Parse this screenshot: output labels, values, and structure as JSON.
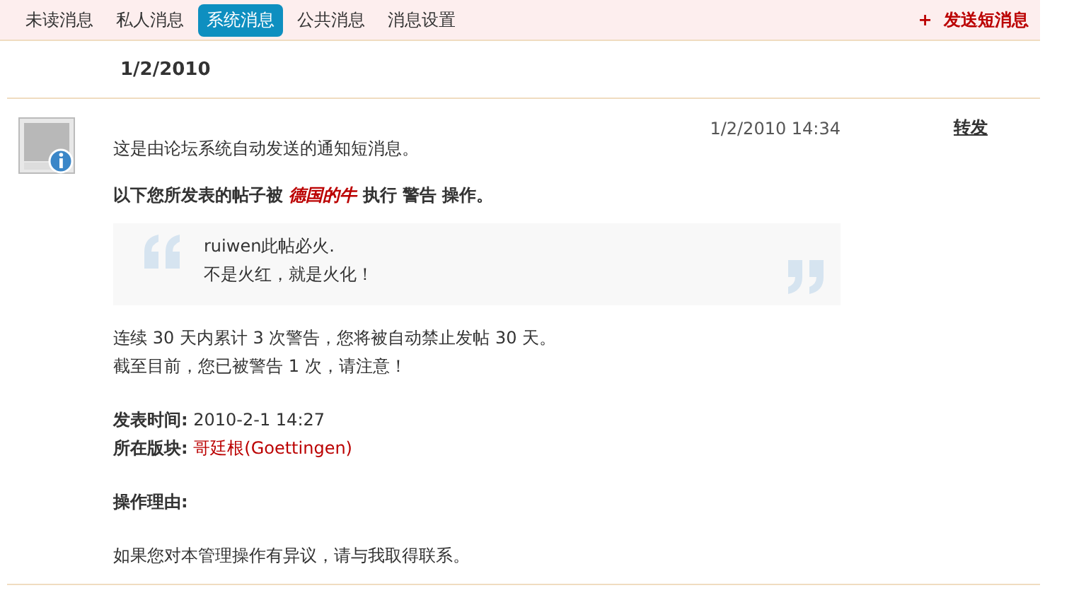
{
  "tabs": [
    {
      "label": "未读消息",
      "selected": false
    },
    {
      "label": "私人消息",
      "selected": false
    },
    {
      "label": "系统消息",
      "selected": true
    },
    {
      "label": "公共消息",
      "selected": false
    },
    {
      "label": "消息设置",
      "selected": false
    }
  ],
  "send_button": {
    "icon": "+",
    "label": "发送短消息"
  },
  "date_header": "1/2/2010",
  "message": {
    "time": "1/2/2010 14:34",
    "forward": "转发",
    "intro": "这是由论坛系统自动发送的通知短消息。",
    "notice": {
      "before": "以下您所发表的帖子被",
      "actor": "德国的牛",
      "after": "执行 警告 操作。"
    },
    "quote": [
      "ruiwen此帖必火.",
      "不是火红，就是火化！"
    ],
    "warning": [
      "连续 30 天内累计 3 次警告，您将被自动禁止发帖 30 天。",
      "截至目前，您已被警告 1 次，请注意！"
    ],
    "post_time": {
      "label": "发表时间:",
      "value": "2010-2-1 14:27"
    },
    "forum": {
      "label": "所在版块:",
      "value": "哥廷根(Goettingen)"
    },
    "reason": {
      "label": "操作理由:"
    },
    "contact": "如果您对本管理操作有异议，请与我取得联系。"
  }
}
